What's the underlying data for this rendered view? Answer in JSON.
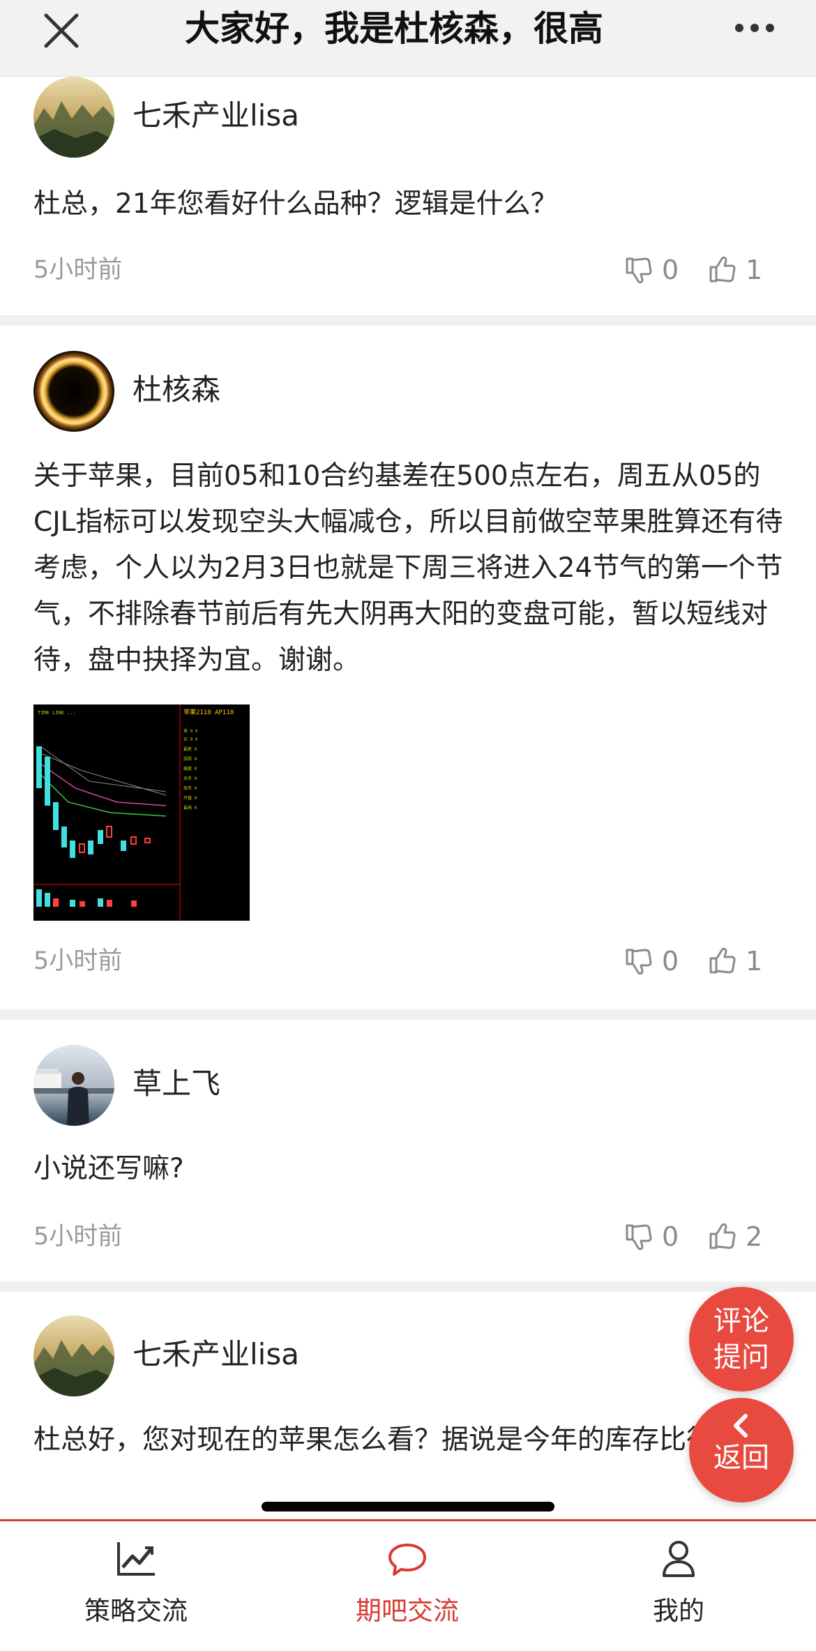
{
  "header": {
    "title": "大家好，我是杜核森，很高",
    "close_icon": "close-icon",
    "more_icon": "more-icon"
  },
  "comments": [
    {
      "author": "七禾产业lisa",
      "text": "杜总，21年您看好什么品种？逻辑是什么？",
      "time": "5小时前",
      "dislikes": "0",
      "likes": "1"
    },
    {
      "author": "杜核森",
      "text": "关于苹果，目前05和10合约基差在500点左右，周五从05的CJL指标可以发现空头大幅减仓，所以目前做空苹果胜算还有待考虑，个人以为2月3日也就是下周三将进入24节气的第一个节气，不排除春节前后有先大阴再大阳的变盘可能，暂以短线对待，盘中抉择为宜。谢谢。",
      "time": "5小时前",
      "dislikes": "0",
      "likes": "1"
    },
    {
      "author": "草上飞",
      "text": "小说还写嘛?",
      "time": "5小时前",
      "dislikes": "0",
      "likes": "2"
    },
    {
      "author": "七禾产业lisa",
      "text": "杜总好，您对现在的苹果怎么看？据说是今年的库存比往年大"
    }
  ],
  "fab": {
    "comment_line1": "评论",
    "comment_line2": "提问",
    "back_label": "返回"
  },
  "bottom_nav": [
    {
      "label": "策略交流",
      "icon": "trend-chart-icon",
      "active": false
    },
    {
      "label": "期吧交流",
      "icon": "chat-bubble-icon",
      "active": true
    },
    {
      "label": "我的",
      "icon": "user-icon",
      "active": false
    }
  ],
  "colors": {
    "accent": "#e84a3f",
    "active_tab": "#d93a32",
    "muted": "#9a9a9a",
    "separator": "#f0f0f0"
  }
}
